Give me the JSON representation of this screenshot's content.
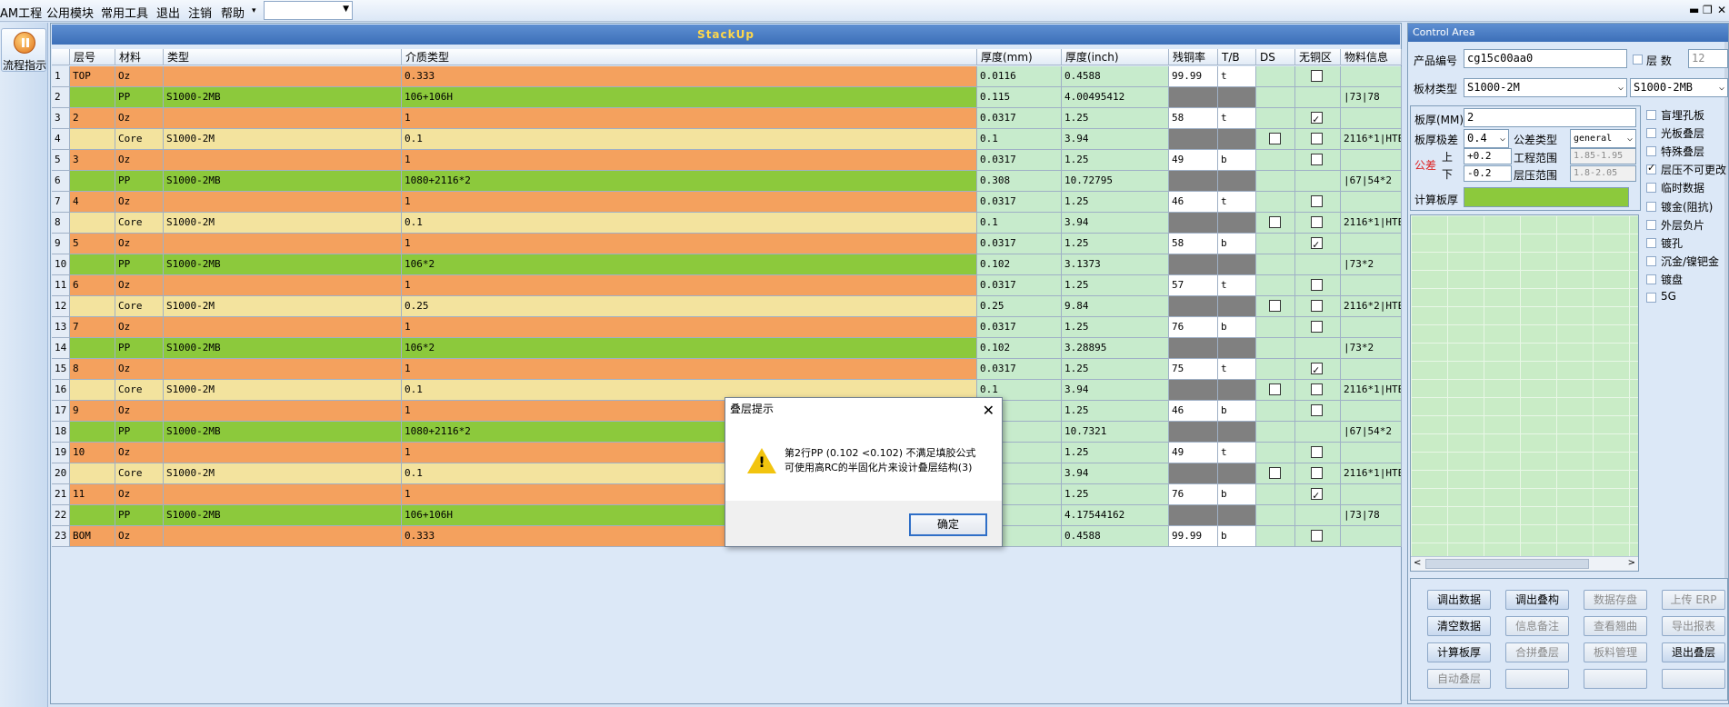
{
  "menu": {
    "items": [
      "AM工程",
      "公用模块",
      "常用工具",
      "退出",
      "注销",
      "帮助"
    ],
    "dropdown_arrow": "▾",
    "combo_value": "",
    "window_buttons": [
      "▬",
      "❐",
      "✕"
    ]
  },
  "left": {
    "flow_label": "流程指示",
    "icon": "flow-icon"
  },
  "stack": {
    "title": "StackUp",
    "headers": [
      "",
      "层号",
      "材料",
      "类型",
      "介质类型",
      "厚度(mm)",
      "厚度(inch)",
      "残铜率",
      "T/B",
      "DS",
      "无铜区",
      "物料信息"
    ],
    "colors": {
      "copper": "#f4a15e",
      "pp": "#8cc93c",
      "core": "#f3e39e",
      "info": "#c7ebcc",
      "gray": "#808080"
    },
    "rows": [
      {
        "n": "1",
        "layer": "TOP",
        "mat": "Oz",
        "type": "",
        "dielec": "0.333",
        "mm": "0.0116",
        "inch": "0.4588",
        "cu": "99.99",
        "tb": "t",
        "ds": null,
        "nocu": false,
        "info": "",
        "kind": "copper"
      },
      {
        "n": "2",
        "layer": "",
        "mat": "PP",
        "type": "S1000-2MB",
        "dielec": "106+106H",
        "mm": "0.115",
        "inch": "4.00495412",
        "cu": "",
        "tb": "",
        "ds": null,
        "nocu": null,
        "info": "|73|78",
        "kind": "pp"
      },
      {
        "n": "3",
        "layer": "2",
        "mat": "Oz",
        "type": "",
        "dielec": "1",
        "mm": "0.0317",
        "inch": "1.25",
        "cu": "58",
        "tb": "t",
        "ds": null,
        "nocu": true,
        "info": "",
        "kind": "copper"
      },
      {
        "n": "4",
        "layer": "",
        "mat": "Core",
        "type": "S1000-2M",
        "dielec": "0.1",
        "mm": "0.1",
        "inch": "3.94",
        "cu": "",
        "tb": "",
        "ds": false,
        "nocu": false,
        "info": "2116*1|HTE",
        "kind": "core"
      },
      {
        "n": "5",
        "layer": "3",
        "mat": "Oz",
        "type": "",
        "dielec": "1",
        "mm": "0.0317",
        "inch": "1.25",
        "cu": "49",
        "tb": "b",
        "ds": null,
        "nocu": false,
        "info": "",
        "kind": "copper"
      },
      {
        "n": "6",
        "layer": "",
        "mat": "PP",
        "type": "S1000-2MB",
        "dielec": "1080+2116*2",
        "mm": "0.308",
        "inch": "10.72795",
        "cu": "",
        "tb": "",
        "ds": null,
        "nocu": null,
        "info": "|67|54*2",
        "kind": "pp"
      },
      {
        "n": "7",
        "layer": "4",
        "mat": "Oz",
        "type": "",
        "dielec": "1",
        "mm": "0.0317",
        "inch": "1.25",
        "cu": "46",
        "tb": "t",
        "ds": null,
        "nocu": false,
        "info": "",
        "kind": "copper"
      },
      {
        "n": "8",
        "layer": "",
        "mat": "Core",
        "type": "S1000-2M",
        "dielec": "0.1",
        "mm": "0.1",
        "inch": "3.94",
        "cu": "",
        "tb": "",
        "ds": false,
        "nocu": false,
        "info": "2116*1|HTE",
        "kind": "core"
      },
      {
        "n": "9",
        "layer": "5",
        "mat": "Oz",
        "type": "",
        "dielec": "1",
        "mm": "0.0317",
        "inch": "1.25",
        "cu": "58",
        "tb": "b",
        "ds": null,
        "nocu": true,
        "info": "",
        "kind": "copper"
      },
      {
        "n": "10",
        "layer": "",
        "mat": "PP",
        "type": "S1000-2MB",
        "dielec": "106*2",
        "mm": "0.102",
        "inch": "3.1373",
        "cu": "",
        "tb": "",
        "ds": null,
        "nocu": null,
        "info": "|73*2",
        "kind": "pp"
      },
      {
        "n": "11",
        "layer": "6",
        "mat": "Oz",
        "type": "",
        "dielec": "1",
        "mm": "0.0317",
        "inch": "1.25",
        "cu": "57",
        "tb": "t",
        "ds": null,
        "nocu": false,
        "info": "",
        "kind": "copper"
      },
      {
        "n": "12",
        "layer": "",
        "mat": "Core",
        "type": "S1000-2M",
        "dielec": "0.25",
        "mm": "0.25",
        "inch": "9.84",
        "cu": "",
        "tb": "",
        "ds": false,
        "nocu": false,
        "info": "2116*2|HTE",
        "kind": "core"
      },
      {
        "n": "13",
        "layer": "7",
        "mat": "Oz",
        "type": "",
        "dielec": "1",
        "mm": "0.0317",
        "inch": "1.25",
        "cu": "76",
        "tb": "b",
        "ds": null,
        "nocu": false,
        "info": "",
        "kind": "copper"
      },
      {
        "n": "14",
        "layer": "",
        "mat": "PP",
        "type": "S1000-2MB",
        "dielec": "106*2",
        "mm": "0.102",
        "inch": "3.28895",
        "cu": "",
        "tb": "",
        "ds": null,
        "nocu": null,
        "info": "|73*2",
        "kind": "pp"
      },
      {
        "n": "15",
        "layer": "8",
        "mat": "Oz",
        "type": "",
        "dielec": "1",
        "mm": "0.0317",
        "inch": "1.25",
        "cu": "75",
        "tb": "t",
        "ds": null,
        "nocu": true,
        "info": "",
        "kind": "copper"
      },
      {
        "n": "16",
        "layer": "",
        "mat": "Core",
        "type": "S1000-2M",
        "dielec": "0.1",
        "mm": "0.1",
        "inch": "3.94",
        "cu": "",
        "tb": "",
        "ds": false,
        "nocu": false,
        "info": "2116*1|HTE",
        "kind": "core"
      },
      {
        "n": "17",
        "layer": "9",
        "mat": "Oz",
        "type": "",
        "dielec": "1",
        "mm": "",
        "inch": "1.25",
        "cu": "46",
        "tb": "b",
        "ds": null,
        "nocu": false,
        "info": "",
        "kind": "copper"
      },
      {
        "n": "18",
        "layer": "",
        "mat": "PP",
        "type": "S1000-2MB",
        "dielec": "1080+2116*2",
        "mm": "",
        "inch": "10.7321",
        "cu": "",
        "tb": "",
        "ds": null,
        "nocu": null,
        "info": "|67|54*2",
        "kind": "pp"
      },
      {
        "n": "19",
        "layer": "10",
        "mat": "Oz",
        "type": "",
        "dielec": "1",
        "mm": "",
        "inch": "1.25",
        "cu": "49",
        "tb": "t",
        "ds": null,
        "nocu": false,
        "info": "",
        "kind": "copper"
      },
      {
        "n": "20",
        "layer": "",
        "mat": "Core",
        "type": "S1000-2M",
        "dielec": "0.1",
        "mm": "",
        "inch": "3.94",
        "cu": "",
        "tb": "",
        "ds": false,
        "nocu": false,
        "info": "2116*1|HTE",
        "kind": "core"
      },
      {
        "n": "21",
        "layer": "11",
        "mat": "Oz",
        "type": "",
        "dielec": "1",
        "mm": "",
        "inch": "1.25",
        "cu": "76",
        "tb": "b",
        "ds": null,
        "nocu": true,
        "info": "",
        "kind": "copper"
      },
      {
        "n": "22",
        "layer": "",
        "mat": "PP",
        "type": "S1000-2MB",
        "dielec": "106+106H",
        "mm": "",
        "inch": "4.17544162",
        "cu": "",
        "tb": "",
        "ds": null,
        "nocu": null,
        "info": "|73|78",
        "kind": "pp"
      },
      {
        "n": "23",
        "layer": "BOM",
        "mat": "Oz",
        "type": "",
        "dielec": "0.333",
        "mm": "",
        "inch": "0.4588",
        "cu": "99.99",
        "tb": "b",
        "ds": null,
        "nocu": false,
        "info": "",
        "kind": "copper"
      }
    ]
  },
  "dialog": {
    "title": "叠层提示",
    "close": "✕",
    "icon": "warning-icon",
    "line1": "第2行PP (0.102 <0.102) 不满足填胶公式",
    "line2": "可使用高RC的半固化片来设计叠层结构(3)",
    "ok": "确定"
  },
  "control": {
    "title": "Control Area",
    "product_no_label": "产品编号",
    "product_no": "cg15c00aa0",
    "layers_label": "层 数",
    "layers": "12",
    "board_type_label": "板材类型",
    "board_type": "S1000-2M",
    "board_type2": "S1000-2MB",
    "thickness_label": "板厚(MM)",
    "thickness": "2",
    "tol_label": "板厚极差",
    "tol": "0.4",
    "tol_type_label": "公差类型",
    "tol_type": "general",
    "tol_word": "公差",
    "upper": "上",
    "lower": "下",
    "upper_val": "+0.2",
    "lower_val": "-0.2",
    "eng_range_label": "工程范围",
    "eng_range": "1.85-1.95",
    "press_range_label": "层压范围",
    "press_range": "1.8-2.05",
    "calc_label": "计算板厚",
    "calc_value": "",
    "options": [
      {
        "label": "盲埋孔板",
        "checked": false
      },
      {
        "label": "光板叠层",
        "checked": false
      },
      {
        "label": "特殊叠层",
        "checked": false
      },
      {
        "label": "层压不可更改",
        "checked": true
      },
      {
        "label": "临时数据",
        "checked": false
      }
    ],
    "options2": [
      {
        "label": "镀金(阻抗)",
        "checked": false
      },
      {
        "label": "外层负片",
        "checked": false
      },
      {
        "label": "镀孔",
        "checked": false
      },
      {
        "label": "沉金/镍钯金",
        "checked": false
      },
      {
        "label": "镀盘",
        "checked": false
      },
      {
        "label": "5G",
        "checked": false
      }
    ],
    "buttons": [
      {
        "label": "调出数据",
        "enabled": true
      },
      {
        "label": "调出叠构",
        "enabled": true
      },
      {
        "label": "数据存盘",
        "enabled": false
      },
      {
        "label": "上传 ERP",
        "enabled": false
      },
      {
        "label": "清空数据",
        "enabled": true
      },
      {
        "label": "信息备注",
        "enabled": false
      },
      {
        "label": "查看翘曲",
        "enabled": false
      },
      {
        "label": "导出报表",
        "enabled": false
      },
      {
        "label": "计算板厚",
        "enabled": true
      },
      {
        "label": "合拼叠层",
        "enabled": false
      },
      {
        "label": "板料管理",
        "enabled": false
      },
      {
        "label": "退出叠层",
        "enabled": true
      },
      {
        "label": "自动叠层",
        "enabled": false
      },
      {
        "label": "",
        "enabled": false
      },
      {
        "label": "",
        "enabled": false
      },
      {
        "label": "",
        "enabled": false
      }
    ]
  }
}
